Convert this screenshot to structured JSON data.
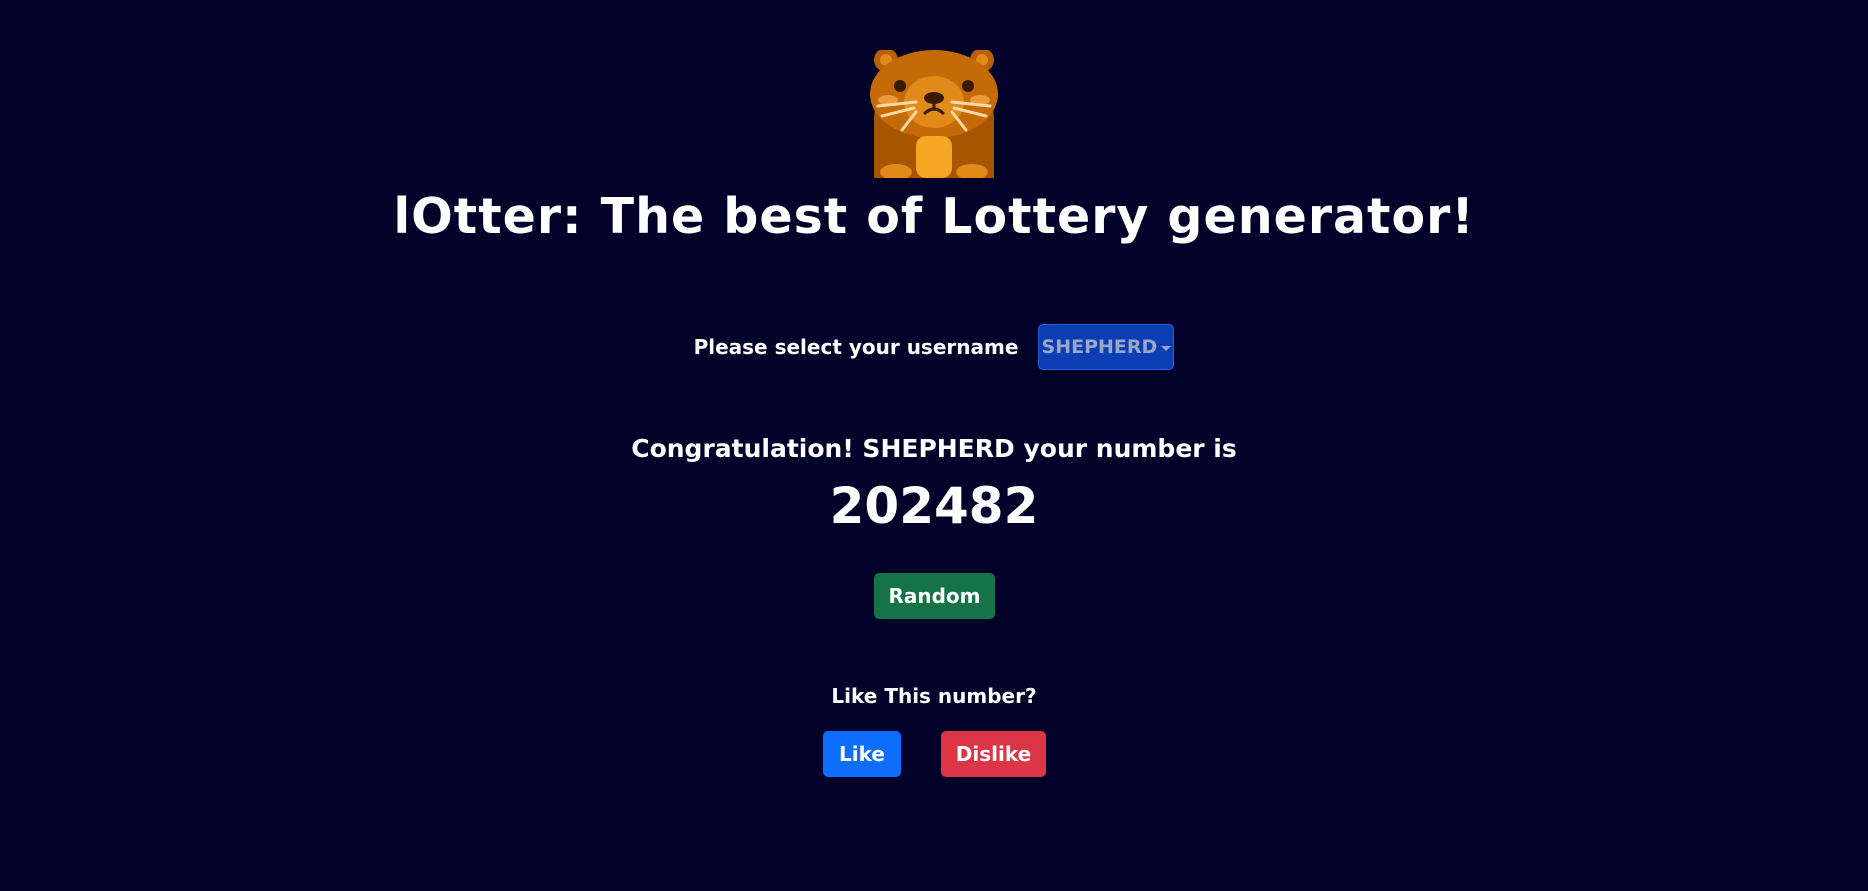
{
  "header": {
    "logo_icon": "otter-icon",
    "title": "lOtter: The best of Lottery generator!"
  },
  "user_select": {
    "label": "Please select your username",
    "selected": "SHEPHERD",
    "button_color": "#0b3db3"
  },
  "result": {
    "message": "Congratulation! SHEPHERD your number is",
    "number": "202482"
  },
  "actions": {
    "random_label": "Random",
    "random_color": "#157347"
  },
  "feedback": {
    "question": "Like This number?",
    "like_label": "Like",
    "dislike_label": "Dislike",
    "like_color": "#0d6efd",
    "dislike_color": "#dc3545"
  },
  "theme": {
    "background": "#01012a"
  }
}
